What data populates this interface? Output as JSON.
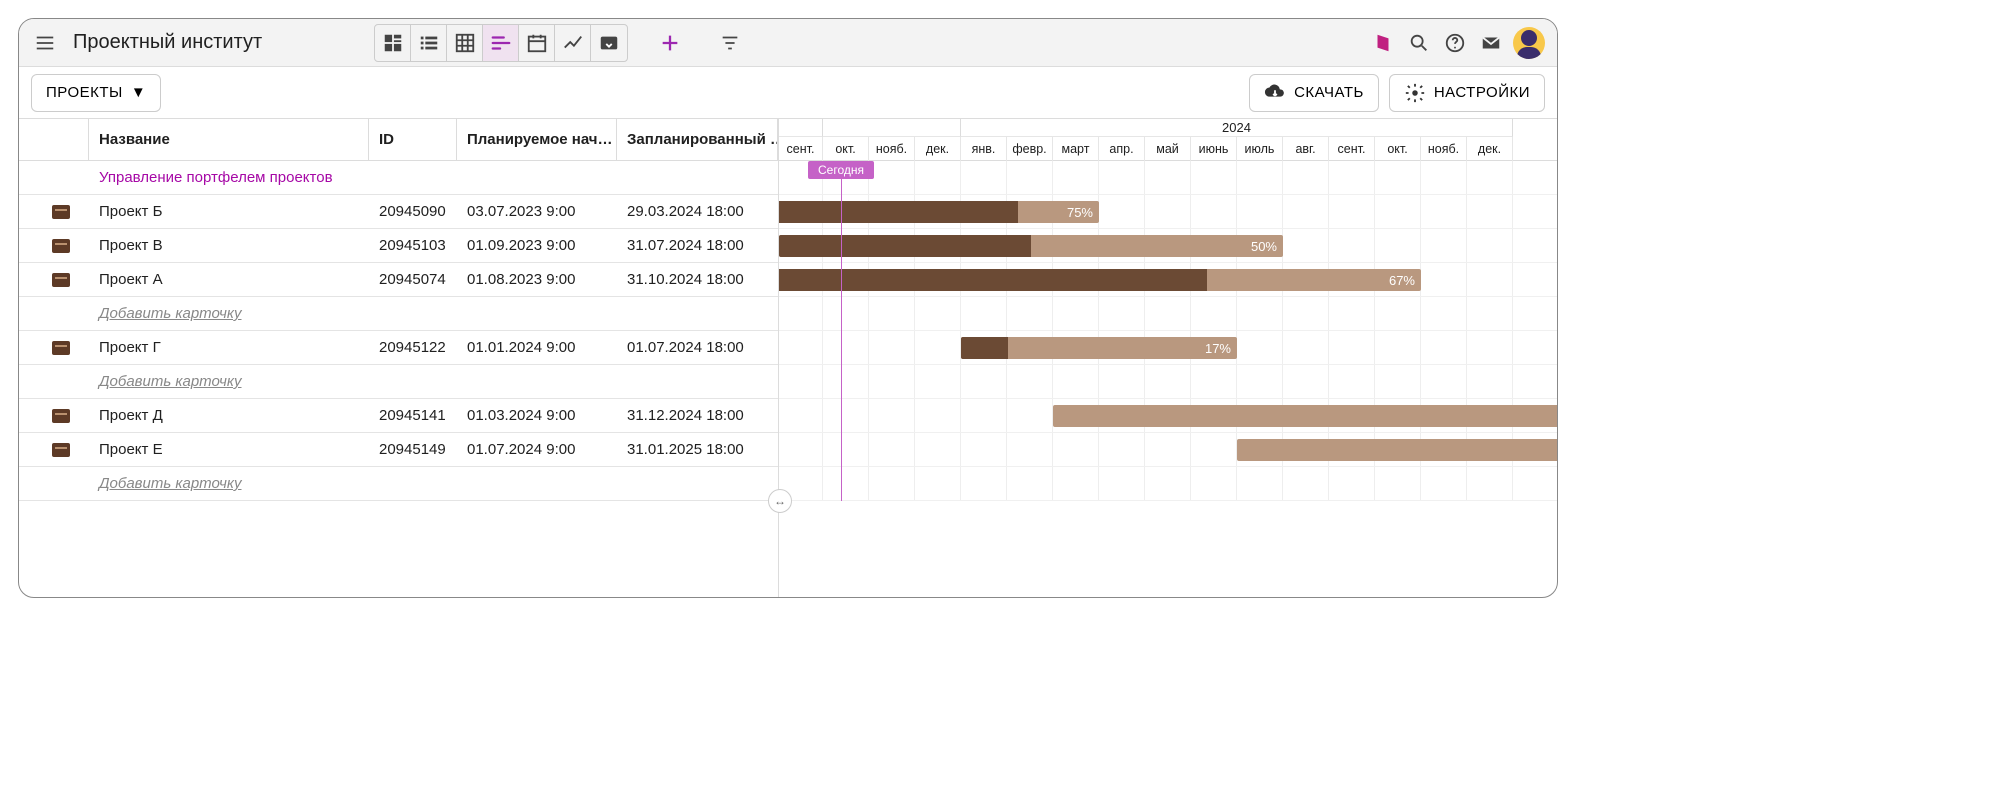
{
  "app": {
    "title": "Проектный институт"
  },
  "toolbar": {
    "download": "СКАЧАТЬ",
    "settings": "НАСТРОЙКИ",
    "projects_btn": "ПРОЕКТЫ"
  },
  "columns": {
    "name": "Название",
    "id": "ID",
    "planned_start": "Планируемое нач…",
    "planned_end": "Запланированный …"
  },
  "group_title": "Управление портфелем проектов",
  "add_card": "Добавить карточку",
  "today_label": "Сегодня",
  "timeline": {
    "start_month_index": 0,
    "year_label": "2024",
    "months": [
      "сент.",
      "окт.",
      "нояб.",
      "дек.",
      "янв.",
      "февр.",
      "март",
      "апр.",
      "май",
      "июнь",
      "июль",
      "авг.",
      "сент.",
      "окт.",
      "нояб.",
      "дек."
    ],
    "month_width": 46,
    "first_col_width": 44,
    "today_month_offset": 1.15
  },
  "rows": [
    {
      "type": "group"
    },
    {
      "type": "proj",
      "name": "Проект Б",
      "id": "20945090",
      "start": "03.07.2023 9:00",
      "end": "29.03.2024 18:00",
      "bar": {
        "start_m": -2.0,
        "end_m": 7.0,
        "pct": 75
      }
    },
    {
      "type": "proj",
      "name": "Проект В",
      "id": "20945103",
      "start": "01.09.2023 9:00",
      "end": "31.07.2024 18:00",
      "bar": {
        "start_m": 0.0,
        "end_m": 11.0,
        "pct": 50
      }
    },
    {
      "type": "proj",
      "name": "Проект А",
      "id": "20945074",
      "start": "01.08.2023 9:00",
      "end": "31.10.2024 18:00",
      "bar": {
        "start_m": -1.0,
        "end_m": 14.0,
        "pct": 67
      }
    },
    {
      "type": "add"
    },
    {
      "type": "proj",
      "name": "Проект Г",
      "id": "20945122",
      "start": "01.01.2024 9:00",
      "end": "01.07.2024 18:00",
      "bar": {
        "start_m": 4.0,
        "end_m": 10.0,
        "pct": 17
      }
    },
    {
      "type": "add"
    },
    {
      "type": "proj",
      "name": "Проект Д",
      "id": "20945141",
      "start": "01.03.2024 9:00",
      "end": "31.12.2024 18:00",
      "bar": {
        "start_m": 6.0,
        "end_m": 18.0,
        "pct": 0,
        "noLabel": true
      }
    },
    {
      "type": "proj",
      "name": "Проект Е",
      "id": "20945149",
      "start": "01.07.2024 9:00",
      "end": "31.01.2025 18:00",
      "bar": {
        "start_m": 10.0,
        "end_m": 18.0,
        "pct": 0,
        "noLabel": true
      }
    },
    {
      "type": "add"
    }
  ],
  "colors": {
    "bar_bg": "#b9987f",
    "bar_fill": "#6b4a34",
    "accent": "#c562c7",
    "group": "#a608a6"
  }
}
